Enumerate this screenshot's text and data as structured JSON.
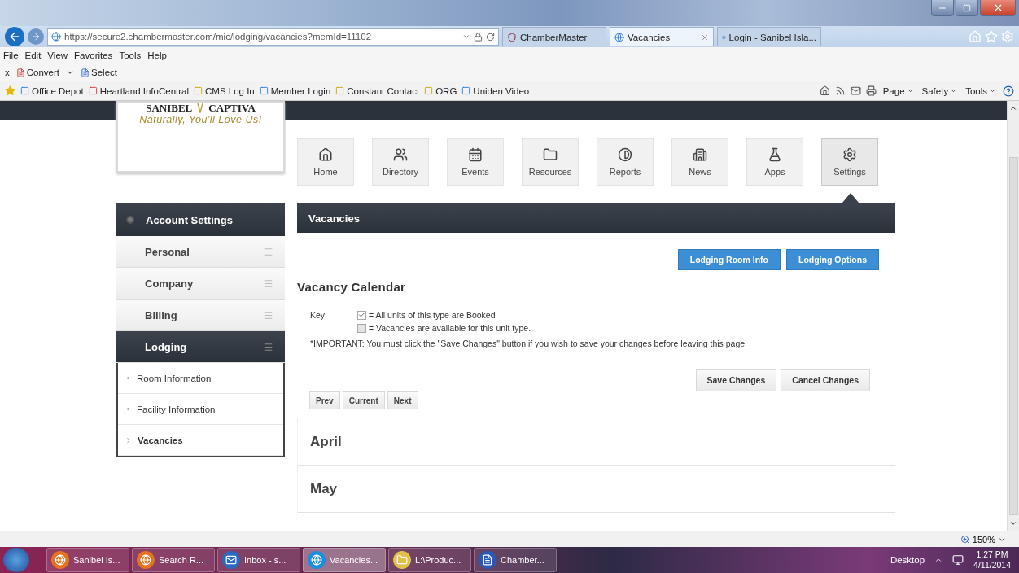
{
  "browser": {
    "address": "https://secure2.chambermaster.com/mic/lodging/vacancies?memId=11102",
    "tabs": [
      {
        "label": "ChamberMaster",
        "kind": "shield",
        "selected": false
      },
      {
        "label": "Vacancies",
        "kind": "ie",
        "selected": true
      },
      {
        "label": "Login - Sanibel Isla...",
        "kind": "ie",
        "selected": false
      }
    ],
    "menu": [
      "File",
      "Edit",
      "View",
      "Favorites",
      "Tools",
      "Help"
    ],
    "toolbar": {
      "close": "x",
      "convert": "Convert",
      "select": "Select"
    },
    "favorites": [
      {
        "label": "Office Depot",
        "kind": "ie"
      },
      {
        "label": "Heartland InfoCentral",
        "kind": "red"
      },
      {
        "label": "CMS Log In",
        "kind": "yellow"
      },
      {
        "label": "Member Login",
        "kind": "ie"
      },
      {
        "label": "Constant Contact",
        "kind": "mail"
      },
      {
        "label": "ORG",
        "kind": "yellow"
      },
      {
        "label": "Uniden Video",
        "kind": "ie"
      }
    ],
    "commands": [
      "Page",
      "Safety",
      "Tools"
    ]
  },
  "page": {
    "logo": {
      "name_left": "SANIBEL",
      "name_right": "CAPTIVA",
      "tagline": "Naturally, You'll Love Us!"
    },
    "nav": [
      {
        "label": "Home",
        "kind": "home",
        "selected": false
      },
      {
        "label": "Directory",
        "kind": "users",
        "selected": false
      },
      {
        "label": "Events",
        "kind": "calendar",
        "selected": false
      },
      {
        "label": "Resources",
        "kind": "folder",
        "selected": false
      },
      {
        "label": "Reports",
        "kind": "chart",
        "selected": false
      },
      {
        "label": "News",
        "kind": "building",
        "selected": false
      },
      {
        "label": "Apps",
        "kind": "flask",
        "selected": false
      },
      {
        "label": "Settings",
        "kind": "gear",
        "selected": true
      }
    ],
    "sidebar": {
      "title": "Account Settings",
      "items": [
        {
          "label": "Personal",
          "selected": false
        },
        {
          "label": "Company",
          "selected": false
        },
        {
          "label": "Billing",
          "selected": false
        },
        {
          "label": "Lodging",
          "selected": true,
          "children": [
            {
              "label": "Room Information",
              "selected": false
            },
            {
              "label": "Facility Information",
              "selected": false
            },
            {
              "label": "Vacancies",
              "selected": true
            }
          ]
        }
      ]
    },
    "main": {
      "title": "Vacancies",
      "top_buttons": [
        "Lodging Room Info",
        "Lodging Options"
      ],
      "heading": "Vacancy Calendar",
      "key": {
        "label": "Key:",
        "items": [
          {
            "checked": true,
            "text": "= All units of this type are Booked"
          },
          {
            "checked": false,
            "text": "= Vacancies are available for this unit type."
          }
        ]
      },
      "note": "*IMPORTANT: You must click the \"Save Changes\" button if you wish to save your changes before leaving this page.",
      "action_buttons": [
        "Save Changes",
        "Cancel Changes"
      ],
      "pager": [
        "Prev",
        "Current",
        "Next"
      ],
      "months": [
        "April",
        "May"
      ]
    }
  },
  "status_bar": {
    "zoom": "150%"
  },
  "taskbar": {
    "items": [
      {
        "label": "Sanibel Is...",
        "kind": "firefox",
        "selected": false
      },
      {
        "label": "Search R...",
        "kind": "firefox",
        "selected": false
      },
      {
        "label": "Inbox - s...",
        "kind": "mail",
        "selected": false
      },
      {
        "label": "Vacancies...",
        "kind": "ie",
        "selected": true
      },
      {
        "label": "L:\\Produc...",
        "kind": "folder",
        "selected": false
      },
      {
        "label": "Chamber...",
        "kind": "word",
        "selected": false
      }
    ],
    "desktop": "Desktop",
    "time": "1:27 PM",
    "date": "4/11/2014"
  }
}
